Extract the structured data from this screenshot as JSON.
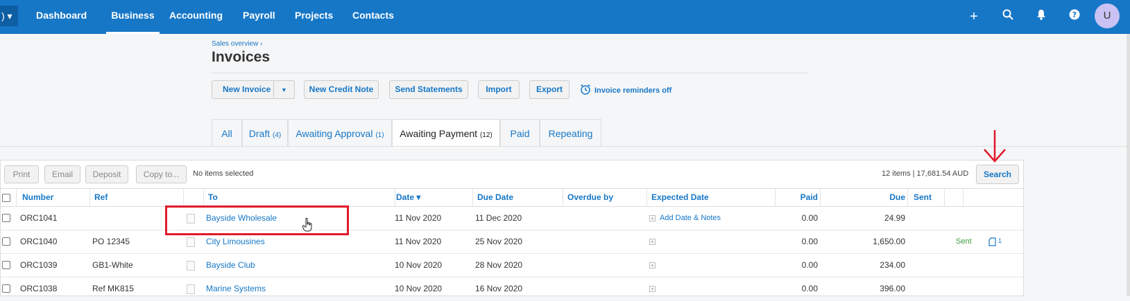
{
  "topbar": {
    "org_label": ") ▾",
    "nav": [
      "Dashboard",
      "Business",
      "Accounting",
      "Payroll",
      "Projects",
      "Contacts"
    ],
    "active_nav": "Business",
    "avatar": "U"
  },
  "page": {
    "breadcrumb": "Sales overview ›",
    "title": "Invoices"
  },
  "toolbar": {
    "new_invoice": "New Invoice",
    "new_credit_note": "New Credit Note",
    "send_statements": "Send Statements",
    "import": "Import",
    "export": "Export",
    "reminders": "Invoice reminders off"
  },
  "tabs": [
    {
      "label": "All",
      "count": ""
    },
    {
      "label": "Draft",
      "count": "(4)"
    },
    {
      "label": "Awaiting Approval",
      "count": "(1)"
    },
    {
      "label": "Awaiting Payment",
      "count": "(12)"
    },
    {
      "label": "Paid",
      "count": ""
    },
    {
      "label": "Repeating",
      "count": ""
    }
  ],
  "actions": {
    "print": "Print",
    "email": "Email",
    "deposit": "Deposit",
    "copy_to": "Copy to...",
    "no_items": "No items selected",
    "summary": "12 items  |  17,681.54  AUD",
    "search": "Search"
  },
  "table": {
    "headers": [
      "Number",
      "Ref",
      "To",
      "Date ▾",
      "Due Date",
      "Overdue by",
      "Expected Date",
      "Paid",
      "Due",
      "Sent"
    ],
    "rows": [
      {
        "number": "ORC1041",
        "ref": "",
        "to": "Bayside Wholesale",
        "date": "11 Nov 2020",
        "due_date": "11 Dec 2020",
        "overdue": "",
        "expected": "Add Date & Notes",
        "paid": "0.00",
        "due": "24.99",
        "sent": "",
        "files": ""
      },
      {
        "number": "ORC1040",
        "ref": "PO 12345",
        "to": "City Limousines",
        "date": "11 Nov 2020",
        "due_date": "25 Nov 2020",
        "overdue": "",
        "expected": "",
        "paid": "0.00",
        "due": "1,650.00",
        "sent": "Sent",
        "files": "1"
      },
      {
        "number": "ORC1039",
        "ref": "GB1-White",
        "to": "Bayside Club",
        "date": "10 Nov 2020",
        "due_date": "28 Nov 2020",
        "overdue": "",
        "expected": "",
        "paid": "0.00",
        "due": "234.00",
        "sent": "",
        "files": ""
      },
      {
        "number": "ORC1038",
        "ref": "Ref MK815",
        "to": "Marine Systems",
        "date": "10 Nov 2020",
        "due_date": "16 Nov 2020",
        "overdue": "",
        "expected": "",
        "paid": "0.00",
        "due": "396.00",
        "sent": "",
        "files": ""
      }
    ]
  },
  "colors": {
    "brand": "#1677c7",
    "annotation": "#e0192a",
    "sent": "#3b9b3b"
  }
}
